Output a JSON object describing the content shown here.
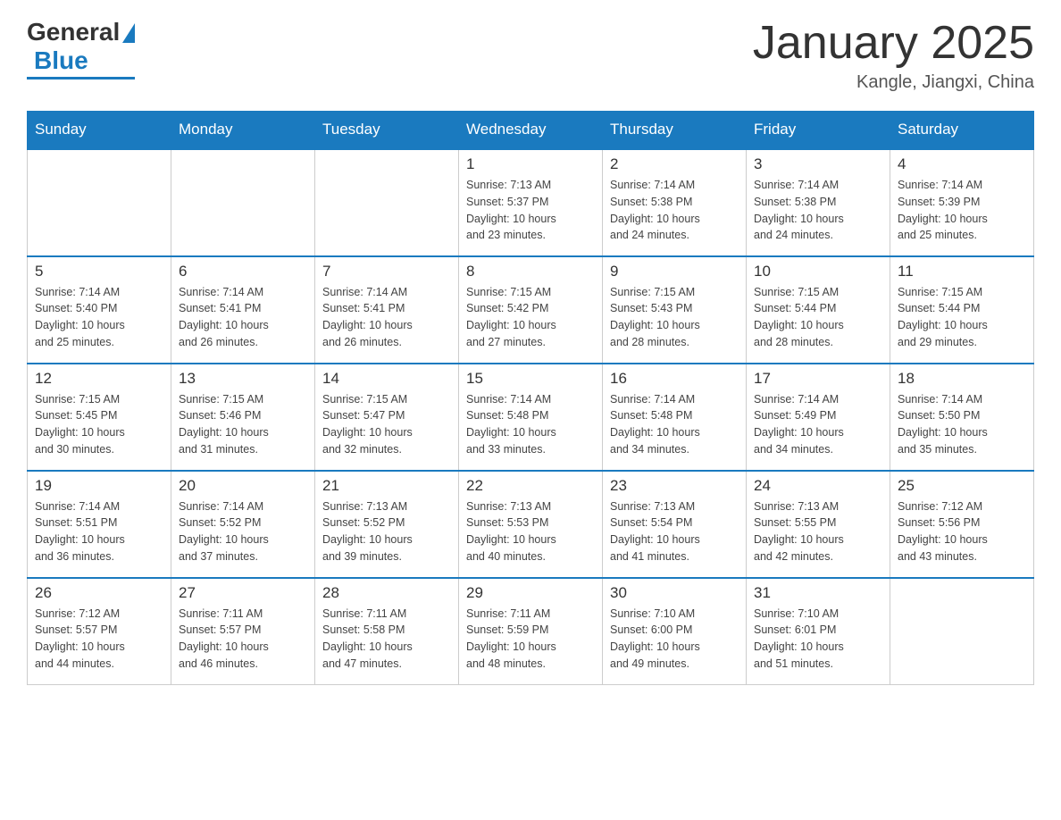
{
  "logo": {
    "general": "General",
    "blue": "Blue"
  },
  "title": "January 2025",
  "location": "Kangle, Jiangxi, China",
  "days_of_week": [
    "Sunday",
    "Monday",
    "Tuesday",
    "Wednesday",
    "Thursday",
    "Friday",
    "Saturday"
  ],
  "weeks": [
    [
      {
        "day": "",
        "info": ""
      },
      {
        "day": "",
        "info": ""
      },
      {
        "day": "",
        "info": ""
      },
      {
        "day": "1",
        "info": "Sunrise: 7:13 AM\nSunset: 5:37 PM\nDaylight: 10 hours\nand 23 minutes."
      },
      {
        "day": "2",
        "info": "Sunrise: 7:14 AM\nSunset: 5:38 PM\nDaylight: 10 hours\nand 24 minutes."
      },
      {
        "day": "3",
        "info": "Sunrise: 7:14 AM\nSunset: 5:38 PM\nDaylight: 10 hours\nand 24 minutes."
      },
      {
        "day": "4",
        "info": "Sunrise: 7:14 AM\nSunset: 5:39 PM\nDaylight: 10 hours\nand 25 minutes."
      }
    ],
    [
      {
        "day": "5",
        "info": "Sunrise: 7:14 AM\nSunset: 5:40 PM\nDaylight: 10 hours\nand 25 minutes."
      },
      {
        "day": "6",
        "info": "Sunrise: 7:14 AM\nSunset: 5:41 PM\nDaylight: 10 hours\nand 26 minutes."
      },
      {
        "day": "7",
        "info": "Sunrise: 7:14 AM\nSunset: 5:41 PM\nDaylight: 10 hours\nand 26 minutes."
      },
      {
        "day": "8",
        "info": "Sunrise: 7:15 AM\nSunset: 5:42 PM\nDaylight: 10 hours\nand 27 minutes."
      },
      {
        "day": "9",
        "info": "Sunrise: 7:15 AM\nSunset: 5:43 PM\nDaylight: 10 hours\nand 28 minutes."
      },
      {
        "day": "10",
        "info": "Sunrise: 7:15 AM\nSunset: 5:44 PM\nDaylight: 10 hours\nand 28 minutes."
      },
      {
        "day": "11",
        "info": "Sunrise: 7:15 AM\nSunset: 5:44 PM\nDaylight: 10 hours\nand 29 minutes."
      }
    ],
    [
      {
        "day": "12",
        "info": "Sunrise: 7:15 AM\nSunset: 5:45 PM\nDaylight: 10 hours\nand 30 minutes."
      },
      {
        "day": "13",
        "info": "Sunrise: 7:15 AM\nSunset: 5:46 PM\nDaylight: 10 hours\nand 31 minutes."
      },
      {
        "day": "14",
        "info": "Sunrise: 7:15 AM\nSunset: 5:47 PM\nDaylight: 10 hours\nand 32 minutes."
      },
      {
        "day": "15",
        "info": "Sunrise: 7:14 AM\nSunset: 5:48 PM\nDaylight: 10 hours\nand 33 minutes."
      },
      {
        "day": "16",
        "info": "Sunrise: 7:14 AM\nSunset: 5:48 PM\nDaylight: 10 hours\nand 34 minutes."
      },
      {
        "day": "17",
        "info": "Sunrise: 7:14 AM\nSunset: 5:49 PM\nDaylight: 10 hours\nand 34 minutes."
      },
      {
        "day": "18",
        "info": "Sunrise: 7:14 AM\nSunset: 5:50 PM\nDaylight: 10 hours\nand 35 minutes."
      }
    ],
    [
      {
        "day": "19",
        "info": "Sunrise: 7:14 AM\nSunset: 5:51 PM\nDaylight: 10 hours\nand 36 minutes."
      },
      {
        "day": "20",
        "info": "Sunrise: 7:14 AM\nSunset: 5:52 PM\nDaylight: 10 hours\nand 37 minutes."
      },
      {
        "day": "21",
        "info": "Sunrise: 7:13 AM\nSunset: 5:52 PM\nDaylight: 10 hours\nand 39 minutes."
      },
      {
        "day": "22",
        "info": "Sunrise: 7:13 AM\nSunset: 5:53 PM\nDaylight: 10 hours\nand 40 minutes."
      },
      {
        "day": "23",
        "info": "Sunrise: 7:13 AM\nSunset: 5:54 PM\nDaylight: 10 hours\nand 41 minutes."
      },
      {
        "day": "24",
        "info": "Sunrise: 7:13 AM\nSunset: 5:55 PM\nDaylight: 10 hours\nand 42 minutes."
      },
      {
        "day": "25",
        "info": "Sunrise: 7:12 AM\nSunset: 5:56 PM\nDaylight: 10 hours\nand 43 minutes."
      }
    ],
    [
      {
        "day": "26",
        "info": "Sunrise: 7:12 AM\nSunset: 5:57 PM\nDaylight: 10 hours\nand 44 minutes."
      },
      {
        "day": "27",
        "info": "Sunrise: 7:11 AM\nSunset: 5:57 PM\nDaylight: 10 hours\nand 46 minutes."
      },
      {
        "day": "28",
        "info": "Sunrise: 7:11 AM\nSunset: 5:58 PM\nDaylight: 10 hours\nand 47 minutes."
      },
      {
        "day": "29",
        "info": "Sunrise: 7:11 AM\nSunset: 5:59 PM\nDaylight: 10 hours\nand 48 minutes."
      },
      {
        "day": "30",
        "info": "Sunrise: 7:10 AM\nSunset: 6:00 PM\nDaylight: 10 hours\nand 49 minutes."
      },
      {
        "day": "31",
        "info": "Sunrise: 7:10 AM\nSunset: 6:01 PM\nDaylight: 10 hours\nand 51 minutes."
      },
      {
        "day": "",
        "info": ""
      }
    ]
  ]
}
